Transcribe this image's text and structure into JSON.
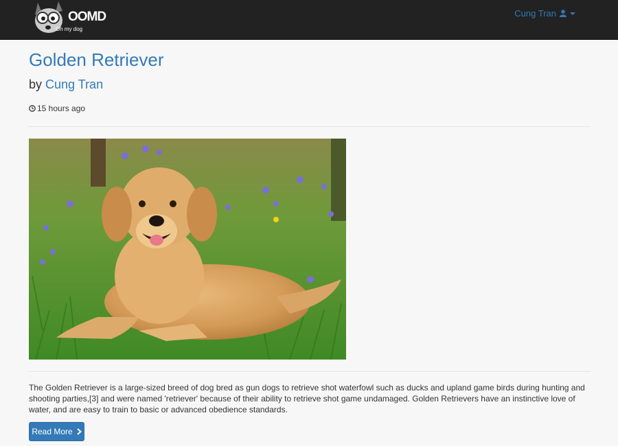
{
  "brand": {
    "logo_mark": "OOMD",
    "logo_tagline": "Oh my dog"
  },
  "nav": {
    "user_name": "Cung Tran",
    "user_icon": "user-icon",
    "caret_icon": "caret-down-icon"
  },
  "post": {
    "title": "Golden Retriever",
    "by_label": "by",
    "author": "Cung Tran",
    "time_icon": "clock-icon",
    "time_ago": "15 hours ago",
    "excerpt": "The Golden Retriever is a large-sized breed of dog bred as gun dogs to retrieve shot waterfowl such as ducks and upland game birds during hunting and shooting parties,[3] and were named 'retriever' because of their ability to retrieve shot game undamaged. Golden Retrievers have an instinctive love of water, and are easy to train to basic or advanced obedience standards.",
    "read_more_label": "Read More",
    "read_more_icon": "chevron-right-icon"
  },
  "colors": {
    "navbar": "#222222",
    "link": "#337ab7",
    "background": "#f7f7f7",
    "button": "#337ab7"
  }
}
